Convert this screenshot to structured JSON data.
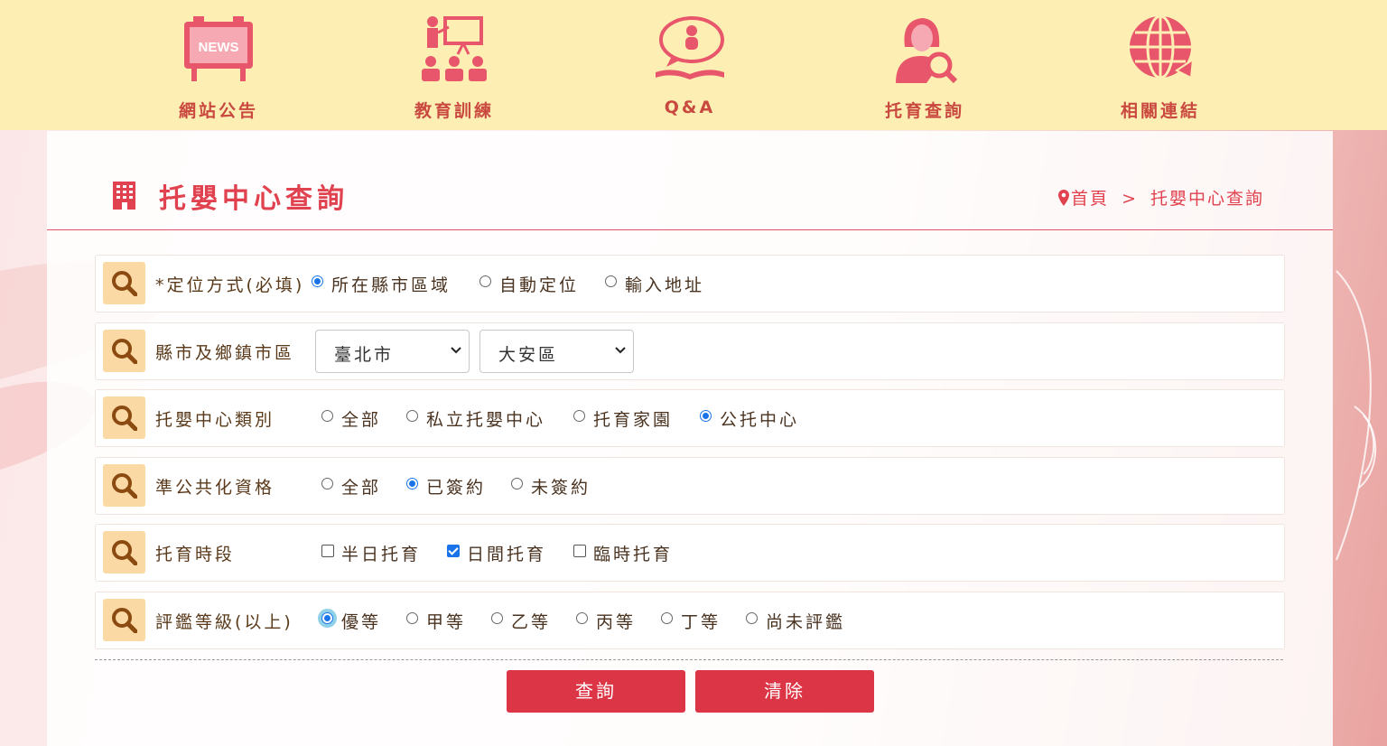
{
  "nav": [
    {
      "label": "網站公告",
      "icon": "news-board-icon",
      "badge": "NEWS"
    },
    {
      "label": "教育訓練",
      "icon": "presentation-classroom-icon"
    },
    {
      "label": "Q&A",
      "icon": "baby-speech-bubble-icon"
    },
    {
      "label": "托育查詢",
      "icon": "person-magnifier-icon"
    },
    {
      "label": "相關連結",
      "icon": "globe-link-icon"
    }
  ],
  "page": {
    "title": "托嬰中心查詢",
    "title_icon": "building-icon"
  },
  "breadcrumb": {
    "home": "首頁",
    "separator": ">",
    "current": "托嬰中心查詢"
  },
  "form": {
    "location_method": {
      "label": "*定位方式(必填)",
      "options": [
        "所在縣市區域",
        "自動定位",
        "輸入地址"
      ],
      "selected": "所在縣市區域"
    },
    "region": {
      "label": "縣市及鄉鎮市區",
      "city": "臺北市",
      "district": "大安區"
    },
    "center_type": {
      "label": "托嬰中心類別",
      "options": [
        "全部",
        "私立托嬰中心",
        "托育家園",
        "公托中心"
      ],
      "selected": "公托中心"
    },
    "public_qualification": {
      "label": "準公共化資格",
      "options": [
        "全部",
        "已簽約",
        "未簽約"
      ],
      "selected": "已簽約"
    },
    "care_period": {
      "label": "托育時段",
      "options": [
        "半日托育",
        "日間托育",
        "臨時托育"
      ],
      "checked": [
        "日間托育"
      ]
    },
    "rating": {
      "label": "評鑑等級(以上)",
      "options": [
        "優等",
        "甲等",
        "乙等",
        "丙等",
        "丁等",
        "尚未評鑑"
      ],
      "selected": "優等"
    }
  },
  "buttons": {
    "search": "查詢",
    "clear": "清除"
  },
  "colors": {
    "nav_bg": "#fdefb3",
    "accent": "#e0424f",
    "button": "#dc3545",
    "icon_bg": "#fbd9a4"
  }
}
